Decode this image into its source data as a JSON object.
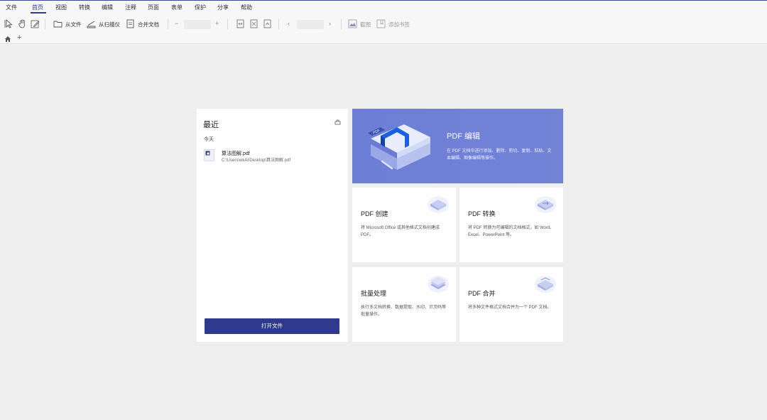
{
  "menu": {
    "items": [
      "文件",
      "首页",
      "视图",
      "转换",
      "编辑",
      "注释",
      "页面",
      "表单",
      "保护",
      "分享",
      "帮助"
    ],
    "active": "首页"
  },
  "toolbar": {
    "from_file": "从文件",
    "from_scanner": "从扫描仪",
    "merge_docs": "合并文档",
    "zoom_out": "−",
    "zoom_in": "+",
    "prev_page": "‹",
    "next_page": "›",
    "screenshot": "截图",
    "add_bookmark": "添加书签"
  },
  "tabs": {
    "add": "+"
  },
  "recent": {
    "title": "最近",
    "day_label": "今天",
    "files": [
      {
        "name": "算法图解.pdf",
        "path": "C:\\Users\\wkAi\\Desktop\\算法图解.pdf"
      }
    ],
    "open_button": "打开文件"
  },
  "hero": {
    "title": "PDF 编辑",
    "desc": "在 PDF 文档中进行添加、删除、剪切、复制、粘贴、文本编辑、图像编辑等操作。"
  },
  "cards": [
    {
      "title": "PDF 创建",
      "desc": "将 Microsoft Office 或其他格式文档创建成 PDF。"
    },
    {
      "title": "PDF 转换",
      "desc": "将 PDF 转换为可编辑的文档格式，如 Word、Excel、PowerPoint 等。"
    },
    {
      "title": "批量处理",
      "desc": "执行多文档转换、数据提取、水印、贝茨码等批量操作。"
    },
    {
      "title": "PDF 合并",
      "desc": "将多种文件格式文档合并为一个 PDF 文档。"
    }
  ],
  "colors": {
    "accent": "#2e3a8c",
    "hero_bg": "#7080d6"
  }
}
